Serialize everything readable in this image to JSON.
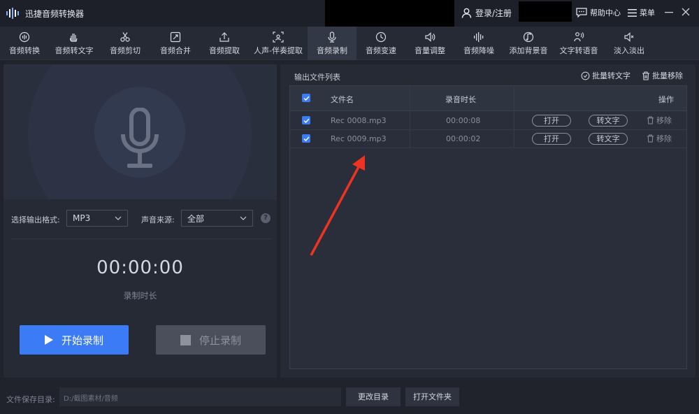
{
  "app": {
    "title": "迅捷音频转换器"
  },
  "header": {
    "login": "登录/注册",
    "help": "帮助中心",
    "menu": "菜单"
  },
  "toolbar": {
    "items": [
      {
        "label": "音频转换",
        "icon": "audio-convert-icon"
      },
      {
        "label": "音频转文字",
        "icon": "hand-text-icon"
      },
      {
        "label": "音频剪切",
        "icon": "scissors-icon"
      },
      {
        "label": "音频合并",
        "icon": "merge-icon"
      },
      {
        "label": "音频提取",
        "icon": "upload-icon"
      },
      {
        "label": "人声-伴奏提取",
        "icon": "voice-extract-icon"
      },
      {
        "label": "音频录制",
        "icon": "microphone-icon",
        "active": true
      },
      {
        "label": "音频变速",
        "icon": "clock-icon"
      },
      {
        "label": "音量调整",
        "icon": "speaker-icon"
      },
      {
        "label": "音频降噪",
        "icon": "waveform-icon"
      },
      {
        "label": "添加背景音",
        "icon": "music-disc-icon"
      },
      {
        "label": "文字转语音",
        "icon": "text-speech-icon"
      },
      {
        "label": "淡入淡出",
        "icon": "fade-icon"
      }
    ]
  },
  "recorder": {
    "format_label": "选择输出格式:",
    "format_value": "MP3",
    "source_label": "声音来源:",
    "source_value": "全部",
    "help_mark": "?",
    "timer": "00:00:00",
    "timer_label": "录制时长",
    "start_label": "开始录制",
    "stop_label": "停止录制"
  },
  "output": {
    "title": "输出文件列表",
    "batch_to_text": "批量转文字",
    "batch_remove": "批量移除",
    "columns": {
      "filename": "文件名",
      "duration": "录音时长",
      "actions": "操作"
    },
    "rows": [
      {
        "filename": "Rec 0008.mp3",
        "duration": "00:00:08",
        "open": "打开",
        "to_text": "转文字",
        "remove": "移除"
      },
      {
        "filename": "Rec 0009.mp3",
        "duration": "00:00:02",
        "open": "打开",
        "to_text": "转文字",
        "remove": "移除"
      }
    ]
  },
  "footer": {
    "save_label": "文件保存目录:",
    "save_path": "D:/截图素材/音频",
    "change_dir": "更改目录",
    "open_folder": "打开文件夹"
  },
  "colors": {
    "accent": "#3b7bf6",
    "arrow": "#ee3322",
    "background": "#20232c",
    "panel": "#262a35"
  }
}
